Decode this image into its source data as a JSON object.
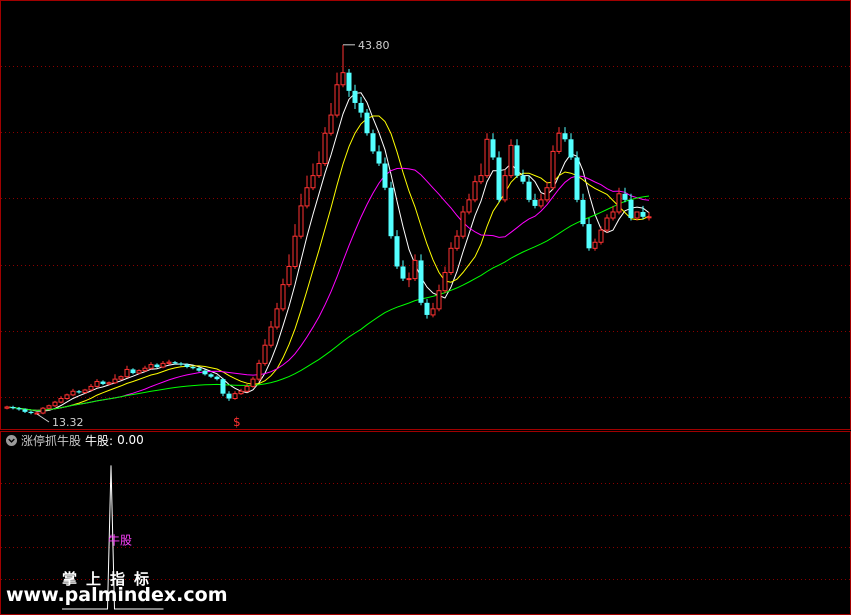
{
  "indicator": {
    "name": "涨停抓牛股",
    "value_label": "牛股:",
    "value": "0.00",
    "signal_label": "牛股"
  },
  "watermark": {
    "cn": "掌上指标",
    "url": "www.palmindex.com"
  },
  "chart_data": [
    {
      "type": "candlestick",
      "title": "",
      "ylim": [
        12.0,
        47.5
      ],
      "grid": true,
      "x": [
        1,
        2,
        3,
        4,
        5,
        6,
        7,
        8,
        9,
        10,
        11,
        12,
        13,
        14,
        15,
        16,
        17,
        18,
        19,
        20,
        21,
        22,
        23,
        24,
        25,
        26,
        27,
        28,
        29,
        30,
        31,
        32,
        33,
        34,
        35,
        36,
        37,
        38,
        39,
        40,
        41,
        42,
        43,
        44,
        45,
        46,
        47,
        48,
        49,
        50,
        51,
        52,
        53,
        54,
        55,
        56,
        57,
        58,
        59,
        60,
        61,
        62,
        63,
        64,
        65,
        66,
        67,
        68,
        69,
        70,
        71,
        72,
        73,
        74,
        75,
        76,
        77,
        78,
        79,
        80,
        81,
        82,
        83,
        84,
        85,
        86,
        87,
        88,
        89,
        90,
        91,
        92,
        93,
        94,
        95,
        96,
        97,
        98,
        99,
        100,
        101,
        102,
        103,
        104,
        105,
        106,
        107,
        108,
        109,
        110,
        111,
        112,
        113,
        114,
        115,
        116,
        117,
        118,
        119,
        120,
        121,
        122,
        123,
        124,
        125,
        126,
        127,
        128,
        129,
        130,
        131,
        132,
        133,
        134,
        135,
        136,
        137,
        138,
        139,
        140
      ],
      "open": [
        13.8,
        13.9,
        13.8,
        13.7,
        13.5,
        13.4,
        13.4,
        13.8,
        14.0,
        14.3,
        14.6,
        14.9,
        15.2,
        15.1,
        15.3,
        15.6,
        16.0,
        15.8,
        15.9,
        16.2,
        16.4,
        17.0,
        16.7,
        16.9,
        17.1,
        17.4,
        17.2,
        17.5,
        17.6,
        17.5,
        17.4,
        17.2,
        17.1,
        16.9,
        16.6,
        16.4,
        16.2,
        15.0,
        14.6,
        15.0,
        15.2,
        15.6,
        16.2,
        17.5,
        19.0,
        20.5,
        22.0,
        24.0,
        25.5,
        28.0,
        30.5,
        32.0,
        33.0,
        34.0,
        36.5,
        38.0,
        40.5,
        41.5,
        40.0,
        39.0,
        38.2,
        36.5,
        35.0,
        34.0,
        32.0,
        28.0,
        25.5,
        24.5,
        24.5,
        26.0,
        22.5,
        21.5,
        22.0,
        23.5,
        25.0,
        27.0,
        28.0,
        30.0,
        31.0,
        32.5,
        33.0,
        36.0,
        34.5,
        31.0,
        33.0,
        35.5,
        33.0,
        32.5,
        31.0,
        30.5,
        31.0,
        32.0,
        35.0,
        36.5,
        36.0,
        34.5,
        31.0,
        29.0,
        27.0,
        27.5,
        28.5,
        29.5,
        30.0,
        31.5,
        31.0,
        29.5,
        30.0,
        29.6
      ],
      "close": [
        13.9,
        13.8,
        13.7,
        13.5,
        13.4,
        13.4,
        13.8,
        14.0,
        14.3,
        14.6,
        14.9,
        15.2,
        15.1,
        15.3,
        15.6,
        16.0,
        15.8,
        15.9,
        16.2,
        16.4,
        17.0,
        16.7,
        16.9,
        17.1,
        17.4,
        17.2,
        17.5,
        17.6,
        17.5,
        17.4,
        17.2,
        17.1,
        16.9,
        16.6,
        16.4,
        16.2,
        15.0,
        14.6,
        15.0,
        15.2,
        15.6,
        16.2,
        17.5,
        19.0,
        20.5,
        22.0,
        24.0,
        25.5,
        28.0,
        30.5,
        32.0,
        33.0,
        34.0,
        36.5,
        38.0,
        40.5,
        41.5,
        40.0,
        39.0,
        38.2,
        36.5,
        35.0,
        34.0,
        32.0,
        28.0,
        25.5,
        24.5,
        24.5,
        26.0,
        22.5,
        21.5,
        22.0,
        23.5,
        25.0,
        27.0,
        28.0,
        30.0,
        31.0,
        32.5,
        33.0,
        36.0,
        34.5,
        31.0,
        33.0,
        35.5,
        33.0,
        32.5,
        31.0,
        30.5,
        31.0,
        32.0,
        35.0,
        36.5,
        36.0,
        34.5,
        31.0,
        29.0,
        27.0,
        27.5,
        28.5,
        29.5,
        30.0,
        31.5,
        31.0,
        29.5,
        30.0,
        29.6,
        29.6
      ],
      "high": [
        14.0,
        14.0,
        13.9,
        13.8,
        13.6,
        13.5,
        13.9,
        14.1,
        14.4,
        14.8,
        15.0,
        15.4,
        15.3,
        15.4,
        15.8,
        16.2,
        16.1,
        16.0,
        16.6,
        16.5,
        17.3,
        17.1,
        17.0,
        17.3,
        17.6,
        17.5,
        17.7,
        17.8,
        17.7,
        17.6,
        17.5,
        17.3,
        17.2,
        17.0,
        16.7,
        16.5,
        16.3,
        15.2,
        15.2,
        15.4,
        15.8,
        16.4,
        17.8,
        19.5,
        21.0,
        22.5,
        24.5,
        26.5,
        29.0,
        31.5,
        33.0,
        34.0,
        35.0,
        37.0,
        39.0,
        41.5,
        43.8,
        41.8,
        40.5,
        39.5,
        38.5,
        36.8,
        35.5,
        34.5,
        32.5,
        28.5,
        26.0,
        25.0,
        26.5,
        26.5,
        22.8,
        22.5,
        24.0,
        25.5,
        27.5,
        28.5,
        30.5,
        31.5,
        33.0,
        34.0,
        36.5,
        36.5,
        35.0,
        33.5,
        36.0,
        36.0,
        33.5,
        33.0,
        31.5,
        31.5,
        32.5,
        35.5,
        37.0,
        37.0,
        36.5,
        35.0,
        31.5,
        29.5,
        27.8,
        28.8,
        29.8,
        30.5,
        32.0,
        32.0,
        31.5,
        30.0,
        30.5,
        30.0
      ],
      "low": [
        13.7,
        13.7,
        13.6,
        13.4,
        13.3,
        13.3,
        13.3,
        13.7,
        13.9,
        14.2,
        14.5,
        14.8,
        15.0,
        15.0,
        15.2,
        15.5,
        15.7,
        15.7,
        15.8,
        16.1,
        16.3,
        16.6,
        16.6,
        16.8,
        17.0,
        17.1,
        17.1,
        17.4,
        17.4,
        17.3,
        17.1,
        17.0,
        16.8,
        16.5,
        16.3,
        16.1,
        14.8,
        14.4,
        14.5,
        14.9,
        15.1,
        15.5,
        16.0,
        17.3,
        18.8,
        20.3,
        21.8,
        23.8,
        25.3,
        27.8,
        30.3,
        31.8,
        32.8,
        33.8,
        36.3,
        37.8,
        40.3,
        39.5,
        38.5,
        37.8,
        36.3,
        34.8,
        33.8,
        31.8,
        27.8,
        25.3,
        24.3,
        23.8,
        24.3,
        22.3,
        21.2,
        21.3,
        21.8,
        23.3,
        24.8,
        26.8,
        27.8,
        29.8,
        30.8,
        32.3,
        32.8,
        34.3,
        30.8,
        30.8,
        32.8,
        32.8,
        32.3,
        30.8,
        30.3,
        30.3,
        30.8,
        31.8,
        34.8,
        35.8,
        34.3,
        30.8,
        28.8,
        26.8,
        26.8,
        27.3,
        28.3,
        29.3,
        29.8,
        30.8,
        29.3,
        29.3,
        29.4,
        29.3
      ],
      "ma_lines": [
        {
          "name": "MA5",
          "color": "#ffffff",
          "period": 5
        },
        {
          "name": "MA10",
          "color": "#ffff00",
          "period": 10
        },
        {
          "name": "MA20",
          "color": "#ff00ff",
          "period": 20
        },
        {
          "name": "MA60",
          "color": "#00ff00",
          "period": 60
        }
      ],
      "annotations": [
        {
          "text": "43.80",
          "x": 57,
          "y": 43.8
        },
        {
          "text": "13.32",
          "x": 6,
          "y": 13.32
        },
        {
          "text": "$",
          "x": 39,
          "y": null
        }
      ]
    },
    {
      "type": "line",
      "title": "",
      "ylim": [
        0,
        1.1
      ],
      "grid": true,
      "x": [
        1,
        2,
        3,
        4,
        5,
        6,
        7,
        8,
        9,
        10,
        11,
        12,
        13,
        14,
        15,
        16,
        17,
        18,
        19,
        20,
        21,
        22,
        23,
        24,
        25,
        26,
        27,
        28,
        29,
        30
      ],
      "series": [
        {
          "name": "牛股",
          "color": "#ffffff",
          "values": [
            0,
            0,
            0,
            0,
            0,
            0,
            0,
            0,
            0,
            0,
            0,
            0,
            0,
            0,
            1,
            0,
            0,
            0,
            0,
            0,
            0,
            0,
            0,
            0,
            0,
            0,
            0,
            0,
            0,
            0
          ]
        }
      ]
    }
  ]
}
